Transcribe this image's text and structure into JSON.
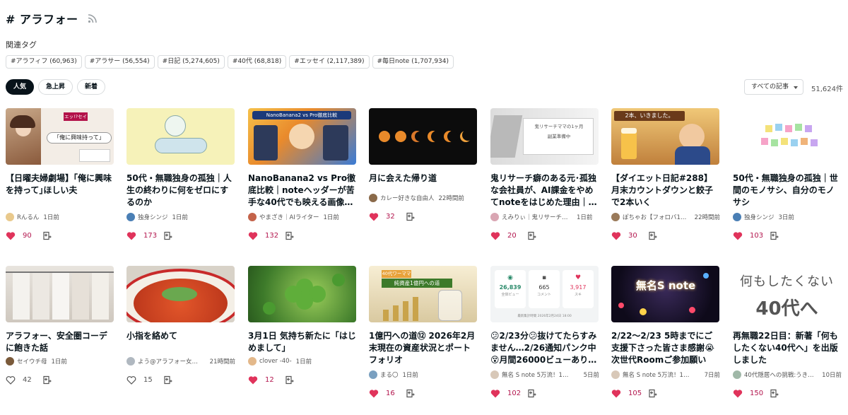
{
  "header": {
    "title": "# アラフォー"
  },
  "related": {
    "label": "関連タグ",
    "tags": [
      "#アラフィフ (60,963)",
      "#アラサー (56,554)",
      "#日記 (5,274,605)",
      "#40代 (68,818)",
      "#エッセイ (2,117,389)",
      "#毎日note (1,707,934)"
    ]
  },
  "sort": {
    "tabs": [
      "人気",
      "急上昇",
      "新着"
    ],
    "active": "人気"
  },
  "filter": {
    "label": "すべての記事",
    "count": "51,624件"
  },
  "colors": {
    "accent": "#b3164e",
    "text": "#08131a",
    "border": "#d9dcde"
  },
  "cards": [
    {
      "title": "【日曜夫婦劇場】｢俺に興味を持って｣ほしい夫",
      "author": "Rんるん",
      "date": "1日前",
      "likes": "90",
      "liked": true,
      "thumb_text": "｢俺に興味持って｣",
      "thumb_badge": "エッ!?セイ"
    },
    {
      "title": "50代・無職独身の孤独｜人生の終わりに何をゼロにするのか",
      "author": "独身シンジ",
      "date": "1日前",
      "likes": "173",
      "liked": true,
      "thumb_text": "",
      "thumb_badge": ""
    },
    {
      "title": "NanoBanana2 vs Pro徹底比較｜noteヘッダーが苦手な40代でも映える画像…",
      "author": "やまざき｜AIライター",
      "date": "1日前",
      "likes": "132",
      "liked": true,
      "thumb_text": "NanoBanana2 vs Pro徹底比較",
      "thumb_badge": ""
    },
    {
      "title": "月に会えた帰り道",
      "author": "カレー好きな自由人",
      "date": "22時間前",
      "likes": "32",
      "liked": true,
      "thumb_text": "",
      "thumb_badge": ""
    },
    {
      "title": "鬼リサーチ癖のある元･孤独な会社員が、AI課金をやめてnoteをはじめた理由｜…",
      "author": "えみりぃ｜鬼リサーチママ",
      "date": "1日前",
      "likes": "20",
      "liked": true,
      "thumb_text": "鬼リサーチママの1ヶ月",
      "thumb_badge": "副業準備中"
    },
    {
      "title": "【ダイエット日記#288】 月末カウントダウンと餃子で2本いく",
      "author": "ぽちゃお【フォロバ1…",
      "date": "22時間前",
      "likes": "30",
      "liked": true,
      "thumb_text": "2本、いきました。",
      "thumb_badge": ""
    },
    {
      "title": "50代・無職独身の孤独｜世間のモノサシ、自分のモノサシ",
      "author": "独身シンジ",
      "date": "3日前",
      "likes": "103",
      "liked": true,
      "thumb_text": "",
      "thumb_badge": ""
    },
    {
      "title": "アラフォー、安全圏コーデに飽きた話",
      "author": "セイウチ母",
      "date": "1日前",
      "likes": "42",
      "liked": false,
      "thumb_text": "",
      "thumb_badge": ""
    },
    {
      "title": "小指を絡めて",
      "author": "よう@アラフォー女…",
      "date": "21時間前",
      "likes": "15",
      "liked": false,
      "thumb_text": "",
      "thumb_badge": ""
    },
    {
      "title": "3月1日 気持ち新たに「はじめまして」",
      "author": "clover -40-",
      "date": "1日前",
      "likes": "12",
      "liked": true,
      "thumb_text": "",
      "thumb_badge": ""
    },
    {
      "title": "1億円への道⑫ 2026年2月末現在の資産状況とポートフォリオ",
      "author": "まる〇",
      "date": "1日前",
      "likes": "16",
      "liked": true,
      "thumb_text": "純資産1億円への道",
      "thumb_badge": "40代ワーママ"
    },
    {
      "title": "😕2/23分😕抜けてたらすみません…2/26通知パンク中😵月間26000ビューあり…",
      "author": "無名 S note 5万流！1か…",
      "date": "5日前",
      "likes": "102",
      "liked": true,
      "thumb_text": "",
      "thumb_badge": ""
    },
    {
      "title": "2/22〜2/23 5時までにご支援下さった皆さま感謝😭 次世代Roomご参加願いま…",
      "author": "無名 S note 5万流！1か…",
      "date": "7日前",
      "likes": "105",
      "liked": true,
      "thumb_text": "無名S note",
      "thumb_badge": ""
    },
    {
      "title": "再無職22日目：新著「何もしたくない40代へ」を出版しました",
      "author": "40代隠居への挑戦:うき…",
      "date": "10日前",
      "likes": "150",
      "liked": true,
      "thumb_text": "何もしたくない",
      "thumb_badge": "40代へ"
    }
  ],
  "stats_thumb": {
    "views": "26,839",
    "views_label": "全体ビュー",
    "comments": "665",
    "comments_label": "コメント",
    "likes": "3,917",
    "likes_label": "スキ",
    "footer": "最新集計時間 2026年2月24日 18:00"
  }
}
